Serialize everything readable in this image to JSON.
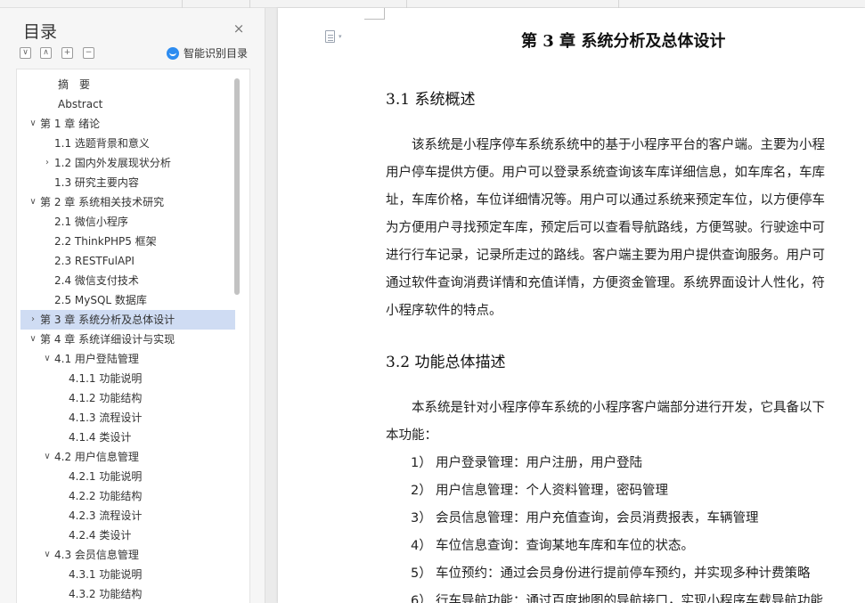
{
  "toc": {
    "title": "目录",
    "close": "×",
    "smart_label": "智能识别目录",
    "items": [
      {
        "label": "摘　要",
        "chev": ""
      },
      {
        "label": "Abstract",
        "chev": ""
      },
      {
        "label": "第 1 章 绪论",
        "chev": "∨"
      },
      {
        "label": "1.1 选题背景和意义",
        "chev": ""
      },
      {
        "label": "1.2 国内外发展现状分析",
        "chev": "›"
      },
      {
        "label": "1.3 研究主要内容",
        "chev": ""
      },
      {
        "label": "第 2 章 系统相关技术研究",
        "chev": "∨"
      },
      {
        "label": "2.1 微信小程序",
        "chev": ""
      },
      {
        "label": "2.2 ThinkPHP5 框架",
        "chev": ""
      },
      {
        "label": "2.3 RESTFulAPI",
        "chev": ""
      },
      {
        "label": "2.4 微信支付技术",
        "chev": ""
      },
      {
        "label": "2.5 MySQL 数据库",
        "chev": ""
      },
      {
        "label": "第 3 章 系统分析及总体设计",
        "chev": "›"
      },
      {
        "label": "第 4 章 系统详细设计与实现",
        "chev": "∨"
      },
      {
        "label": "4.1 用户登陆管理",
        "chev": "∨"
      },
      {
        "label": "4.1.1 功能说明",
        "chev": ""
      },
      {
        "label": "4.1.2 功能结构",
        "chev": ""
      },
      {
        "label": "4.1.3 流程设计",
        "chev": ""
      },
      {
        "label": "4.1.4 类设计",
        "chev": ""
      },
      {
        "label": "4.2 用户信息管理",
        "chev": "∨"
      },
      {
        "label": "4.2.1 功能说明",
        "chev": ""
      },
      {
        "label": "4.2.2 功能结构",
        "chev": ""
      },
      {
        "label": "4.2.3 流程设计",
        "chev": ""
      },
      {
        "label": "4.2.4 类设计",
        "chev": ""
      },
      {
        "label": "4.3 会员信息管理",
        "chev": "∨"
      },
      {
        "label": "4.3.1 功能说明",
        "chev": ""
      },
      {
        "label": "4.3.2 功能结构",
        "chev": ""
      }
    ]
  },
  "doc": {
    "chapter_title": "第 3 章  系统分析及总体设计",
    "s31_title": "3.1 系统概述",
    "s31_lines": [
      "　　该系统是小程序停车系统系统中的基于小程序平台的客户端。主要为小程",
      "用户停车提供方便。用户可以登录系统查询该车库详细信息，如车库名，车库",
      "址，车库价格，车位详细情况等。用户可以通过系统来预定车位，以方便停车",
      "为方便用户寻找预定车库，预定后可以查看导航路线，方便驾驶。行驶途中可",
      "进行行车记录，记录所走过的路线。客户端主要为用户提供查询服务。用户可",
      "通过软件查询消费详情和充值详情，方便资金管理。系统界面设计人性化，符",
      "小程序软件的特点。"
    ],
    "s32_title": "3.2 功能总体描述",
    "s32_lines": [
      "　　本系统是针对小程序停车系统的小程序客户端部分进行开发，它具备以下",
      "本功能："
    ],
    "list": [
      {
        "num": "1）",
        "text": "用户登录管理：用户注册，用户登陆"
      },
      {
        "num": "2）",
        "text": "用户信息管理：个人资料管理，密码管理"
      },
      {
        "num": "3）",
        "text": "会员信息管理：用户充值查询，会员消费报表，车辆管理"
      },
      {
        "num": "4）",
        "text": "车位信息查询：查询某地车库和车位的状态。"
      },
      {
        "num": "5）",
        "text": "车位预约：通过会员身份进行提前停车预约，并实现多种计费策略"
      },
      {
        "num": "6）",
        "text": "行车导航功能：通过百度地图的导航接口，实现小程序车载导航功能"
      }
    ]
  }
}
